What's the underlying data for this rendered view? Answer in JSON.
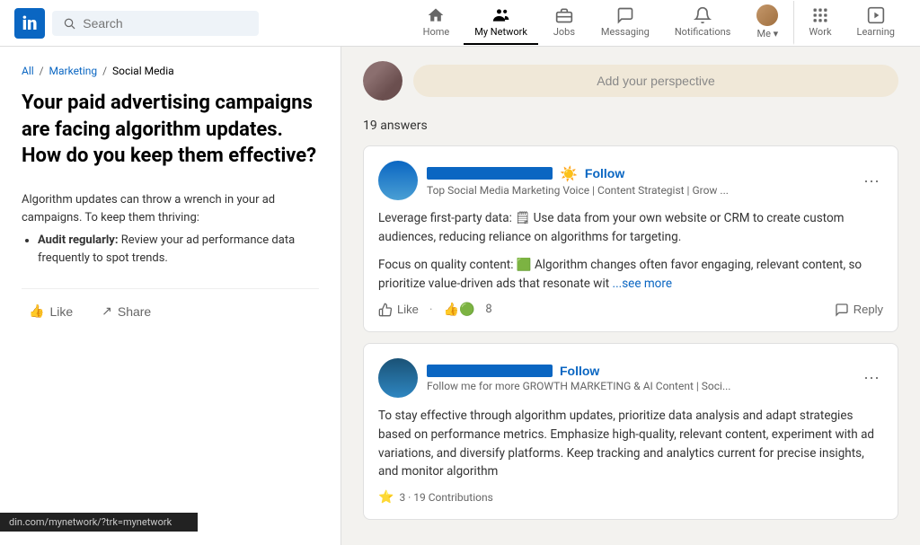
{
  "nav": {
    "logo": "in",
    "search_placeholder": "Search",
    "items": [
      {
        "id": "home",
        "label": "Home",
        "icon": "home"
      },
      {
        "id": "my-network",
        "label": "My Network",
        "icon": "people",
        "active": true
      },
      {
        "id": "jobs",
        "label": "Jobs",
        "icon": "briefcase"
      },
      {
        "id": "messaging",
        "label": "Messaging",
        "icon": "chat"
      },
      {
        "id": "notifications",
        "label": "Notifications",
        "icon": "bell"
      },
      {
        "id": "me",
        "label": "Me ▾",
        "icon": "person"
      },
      {
        "id": "work",
        "label": "Work",
        "icon": "grid",
        "has_dropdown": true
      },
      {
        "id": "learning",
        "label": "Learning",
        "icon": "play"
      }
    ]
  },
  "breadcrumb": {
    "all": "All",
    "marketing": "Marketing",
    "current": "Social Media"
  },
  "question": {
    "title": "Your paid advertising campaigns are facing algorithm updates. How do you keep them effective?",
    "description": "Algorithm updates can throw a wrench in your ad campaigns. To keep them thriving:",
    "bullets": [
      {
        "bold": "Audit regularly:",
        "text": " Review your ad performance data frequently to spot trends."
      }
    ]
  },
  "bottom_actions": [
    {
      "id": "like",
      "label": "Like",
      "icon": "👍"
    },
    {
      "id": "share",
      "label": "Share",
      "icon": "↗"
    }
  ],
  "url_bar": "din.com/mynetwork/?trk=mynetwork",
  "perspective": {
    "placeholder": "Add your perspective"
  },
  "answers": {
    "count_label": "19 answers"
  },
  "answer_1": {
    "subtitle": "Top Social Media Marketing Voice | Content Strategist | Grow ...",
    "follow_label": "Follow",
    "more_label": "···",
    "text_1": "Leverage first-party data: 🗒 Use data from your own website or CRM to create custom audiences, reducing reliance on algorithms for targeting.",
    "text_2": "Focus on quality content: 🟩 Algorithm changes often favor engaging, relevant content, so prioritize value-driven ads that resonate wit",
    "see_more": "...see more",
    "like_label": "Like",
    "reaction_count": "8",
    "reply_label": "Reply"
  },
  "answer_2": {
    "subtitle": "Follow me for more GROWTH MARKETING & AI Content | Soci...",
    "follow_label": "Follow",
    "more_label": "···",
    "text": "To stay effective through algorithm updates, prioritize data analysis and adapt strategies based on performance metrics. Emphasize high-quality, relevant content, experiment with ad variations, and diversify platforms. Keep tracking and analytics current for precise insights, and monitor algorithm",
    "contributions_label": "3 · 19 Contributions",
    "contrib_icon": "⭐"
  }
}
